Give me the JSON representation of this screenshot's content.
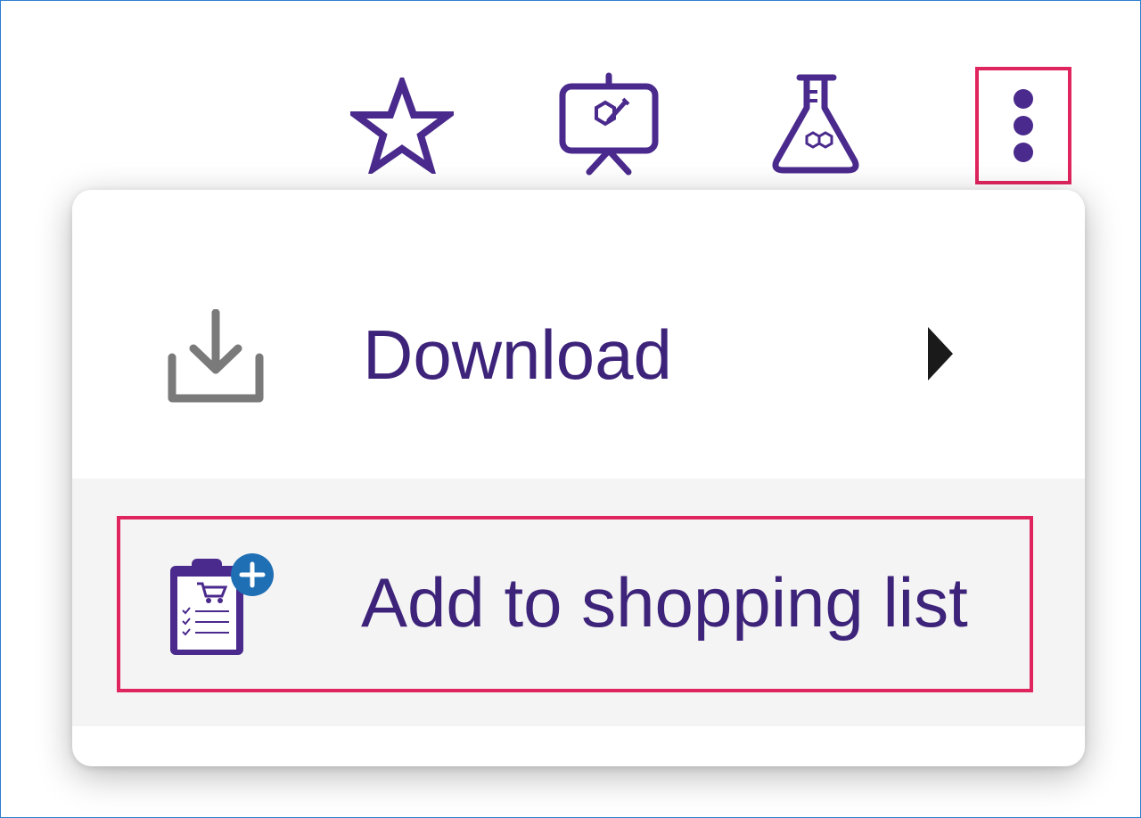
{
  "colors": {
    "accent_purple": "#4a2a8c",
    "label_purple": "#3d2379",
    "highlight_red": "#e0245e",
    "download_icon_gray": "#7a7a7a",
    "badge_blue": "#1f6fb5",
    "border_blue": "#2f7fd1"
  },
  "toolbar": {
    "icons": [
      "star-icon",
      "presentation-board-icon",
      "flask-icon",
      "more-vertical-icon"
    ]
  },
  "menu": {
    "items": [
      {
        "label": "Download",
        "icon": "download-icon",
        "has_submenu": true
      },
      {
        "label": "Add to shopping list",
        "icon": "shopping-list-add-icon",
        "has_submenu": false
      }
    ]
  }
}
